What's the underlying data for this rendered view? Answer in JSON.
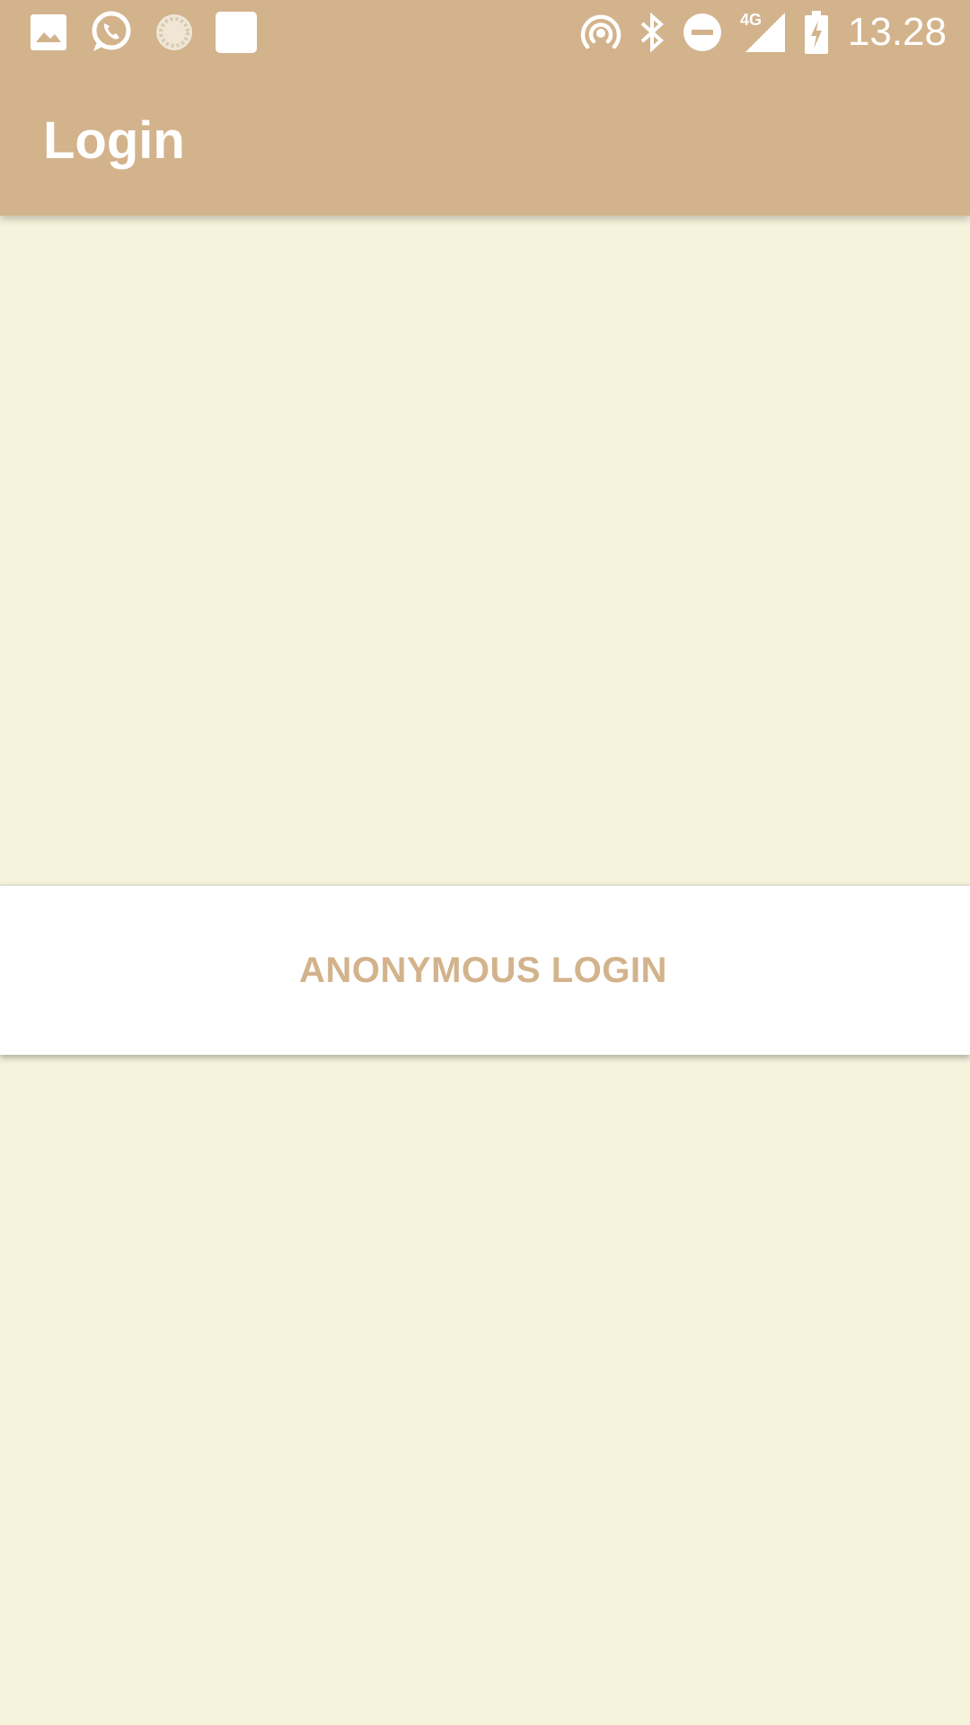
{
  "status_bar": {
    "time": "13.28",
    "network_type": "4G",
    "left_icons": [
      "gallery-icon",
      "whatsapp-icon",
      "loading-icon",
      "square-notification-icon"
    ],
    "right_icons": [
      "hotspot-icon",
      "bluetooth-icon",
      "do-not-disturb-icon",
      "cellular-signal-icon",
      "battery-charging-icon"
    ]
  },
  "app_bar": {
    "title": "Login"
  },
  "login": {
    "anonymous_button_label": "ANONYMOUS LOGIN"
  },
  "colors": {
    "primary": "#D3B38C",
    "background": "#F5F3DC",
    "panel": "#FFFFFF",
    "on_primary": "#FFFFFF"
  }
}
